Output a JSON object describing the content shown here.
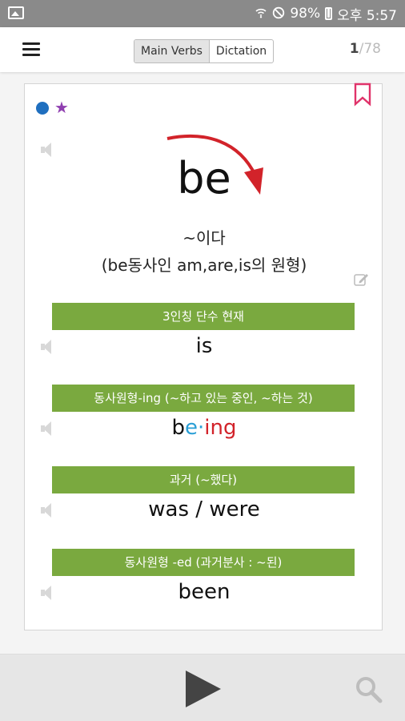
{
  "status_bar": {
    "icons": [
      "gallery-icon",
      "wifi-icon",
      "mute-icon",
      "battery-icon"
    ],
    "battery": "98%",
    "time": "오후 5:57"
  },
  "app_bar": {
    "menu_icon": "hamburger-icon",
    "tabs": [
      {
        "label": "Main Verbs",
        "active": true
      },
      {
        "label": "Dictation",
        "active": false
      }
    ],
    "counter": {
      "current": "1",
      "total": "/78"
    }
  },
  "card": {
    "icons": [
      "blue-dot-icon",
      "star-icon",
      "bookmark-icon",
      "speaker-icon",
      "edit-icon"
    ],
    "word": "be",
    "meaning_line1": "~이다",
    "meaning_line2": "(be동사인 am,are,is의 원형)",
    "sections": [
      {
        "header": "3인칭 단수 현재",
        "form": "is"
      },
      {
        "header": "동사원형-ing (~하고 있는 중인, ~하는 것)",
        "form_parts": [
          "b",
          "e·",
          "ing"
        ]
      },
      {
        "header": "과거 (~했다)",
        "form": "was / were"
      },
      {
        "header": "동사원형 -ed (과거분사 : ~된)",
        "form": "been"
      }
    ],
    "colors": {
      "header_green": "#7aa93f",
      "ing_blue": "#2a9fd6",
      "ing_red": "#d2232a",
      "bookmark": "#e0336a",
      "arrow": "#d2232a"
    }
  },
  "bottom_bar": {
    "icons": [
      "play-icon",
      "search-icon"
    ]
  }
}
